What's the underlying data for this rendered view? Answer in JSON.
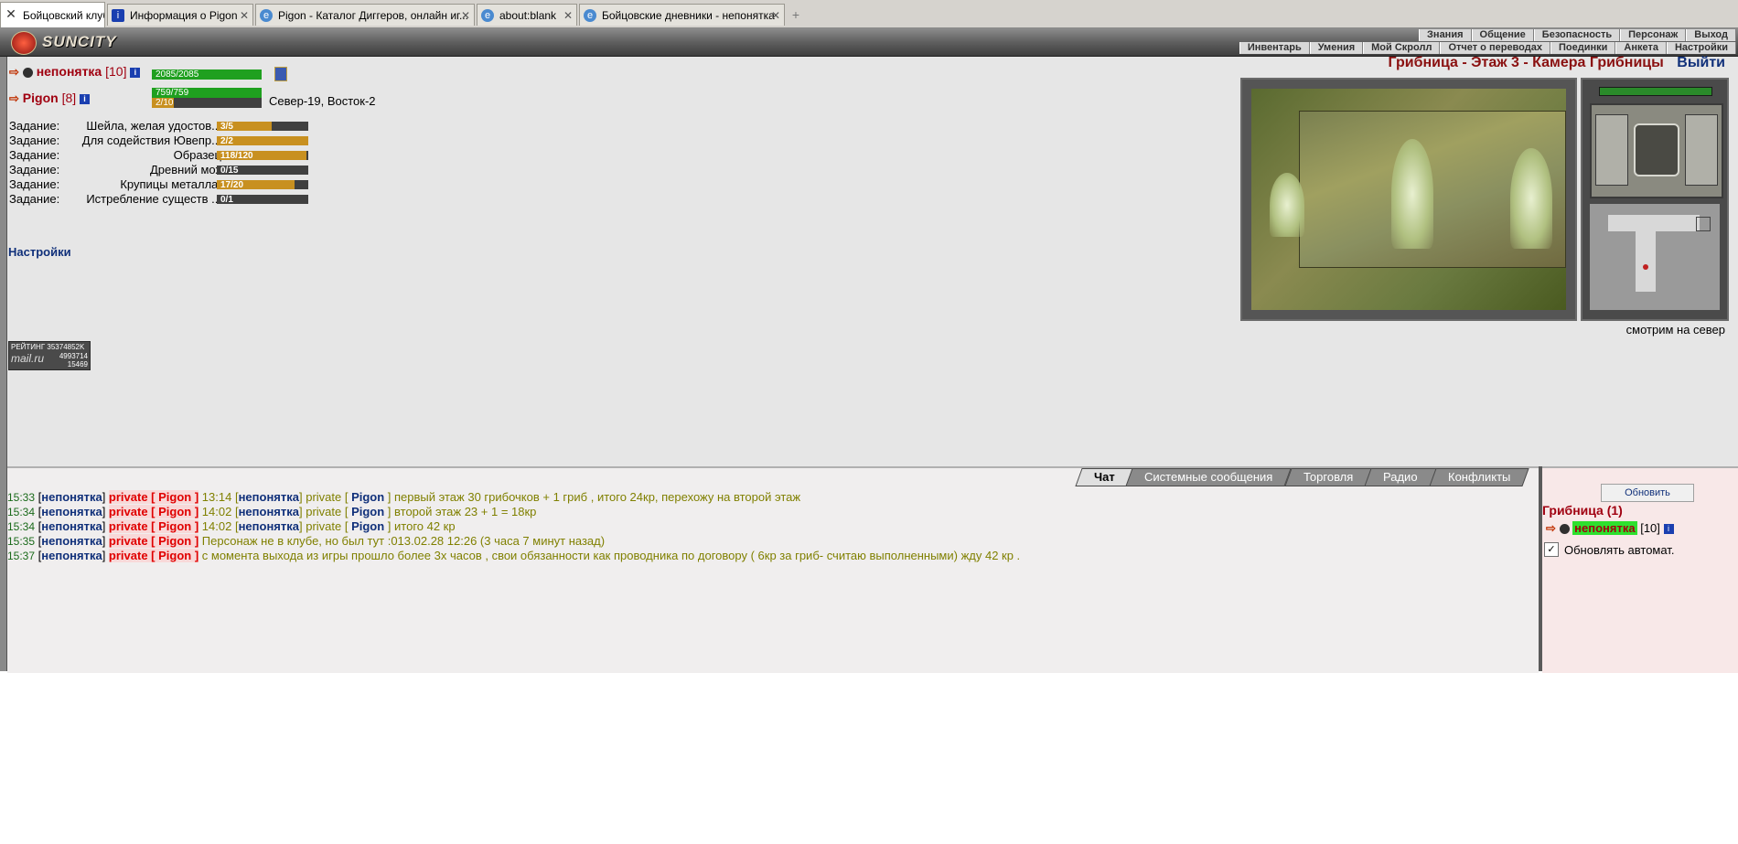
{
  "browser": {
    "tabs": [
      {
        "label": "Бойцовский клуб",
        "icon": "fight-club-icon"
      },
      {
        "label": "Информация о Pigon",
        "icon": "info-icon"
      },
      {
        "label": "Pigon - Каталог Диггеров, онлайн иг...",
        "icon": "web-icon"
      },
      {
        "label": "about:blank",
        "icon": "web-icon"
      },
      {
        "label": "Бойцовские дневники - непонятка",
        "icon": "web-icon"
      }
    ],
    "new_tab": "+"
  },
  "header": {
    "logo": "SUNCITY",
    "menu_top": [
      "Знания",
      "Общение",
      "Безопасность",
      "Персонаж",
      "Выход"
    ],
    "menu_bottom": [
      "Инвентарь",
      "Умения",
      "Мой Скролл",
      "Отчет о переводах",
      "Поединки",
      "Анкета",
      "Настройки"
    ]
  },
  "player": {
    "name": "непонятка",
    "level": "[10]",
    "hp": "2085/2085"
  },
  "companion": {
    "name": "Pigon",
    "level": "[8]",
    "hp": "759/759",
    "mana": "2/10",
    "coords": "Север-19, Восток-2"
  },
  "quests": [
    {
      "label": "Задание:",
      "name": "Шейла, желая удостов...",
      "progress": "3/5",
      "fraction": 0.6
    },
    {
      "label": "Задание:",
      "name": "Для содействия Ювепр...",
      "progress": "2/2",
      "fraction": 1.0
    },
    {
      "label": "Задание:",
      "name": "Образец",
      "progress": "118/120",
      "fraction": 0.98
    },
    {
      "label": "Задание:",
      "name": "Древний мох",
      "progress": "0/15",
      "fraction": 0.0
    },
    {
      "label": "Задание:",
      "name": "Крупицы металла.",
      "progress": "17/20",
      "fraction": 0.85
    },
    {
      "label": "Задание:",
      "name": "Истребление существ ...",
      "progress": "0/1",
      "fraction": 0.0
    }
  ],
  "settings_link": "Настройки",
  "counter": {
    "line1": "РЕЙТИНГ 35374852K",
    "brand": "mail.ru",
    "line2": "4993714",
    "line3": "15469"
  },
  "location": {
    "title": "Грибница - Этаж 3 - Камера Грибницы",
    "exit": "Выйти",
    "direction": "смотрим на север"
  },
  "chat": {
    "tabs": [
      "Чат",
      "Системные сообщения",
      "Торговля",
      "Радио",
      "Конфликты"
    ],
    "active_tab": "Чат",
    "lines": [
      {
        "time": "15:33",
        "from": "непонятка",
        "priv": "private [ Pigon ]",
        "inner_time": "13:14",
        "inner_from": "непонятка",
        "inner_to": "Pigon",
        "text": "первый этаж 30 грибочков + 1 гриб , итого 24кр, перехожу на второй этаж"
      },
      {
        "time": "15:34",
        "from": "непонятка",
        "priv": "private [ Pigon ]",
        "inner_time": "14:02",
        "inner_from": "непонятка",
        "inner_to": "Pigon",
        "text": "второй этаж 23 + 1 = 18кр"
      },
      {
        "time": "15:34",
        "from": "непонятка",
        "priv": "private [ Pigon ]",
        "inner_time": "14:02",
        "inner_from": "непонятка",
        "inner_to": "Pigon",
        "text": "итого 42 кр"
      },
      {
        "time": "15:35",
        "from": "непонятка",
        "priv": "private [ Pigon ]",
        "text": "Персонаж не в клубе, но был тут :013.02.28 12:26 (3 часа 7 минут назад)"
      },
      {
        "time": "15:37",
        "from": "непонятка",
        "priv": "private [ Pigon ]",
        "text": "с момента выхода из игры прошло более 3х часов , свои обязанности как проводника по договору ( 6кр за гриб- считаю выполненными) жду 42 кр ."
      }
    ]
  },
  "online": {
    "refresh": "Обновить",
    "location_count": "Грибница (1)",
    "user_name": "непонятка",
    "user_level": "[10]",
    "auto_refresh": "Обновлять автомат.",
    "auto_checked": "✓"
  }
}
